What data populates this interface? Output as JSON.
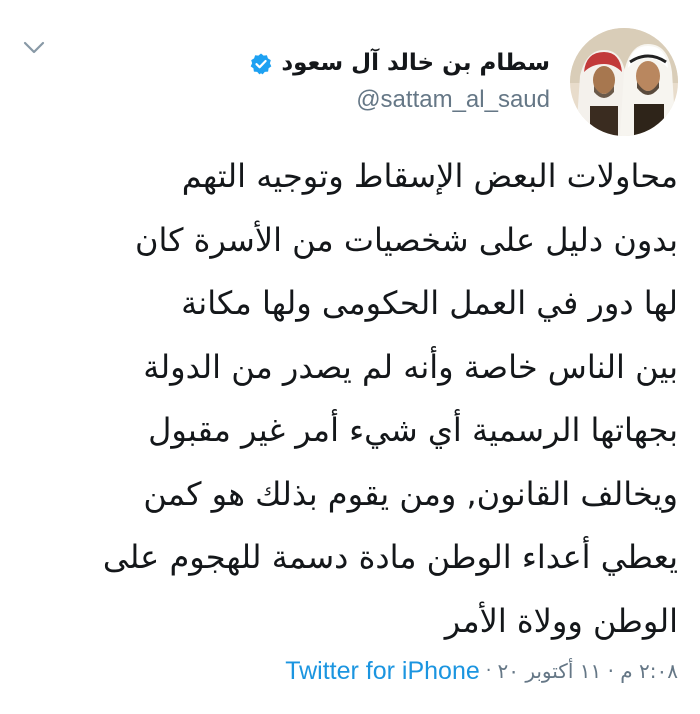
{
  "author": {
    "display_name": "سطام بن خالد آل سعود",
    "handle": "@sattam_al_saud",
    "verified": true
  },
  "icons": {
    "verified": "verified-badge-icon",
    "menu": "chevron-down-icon"
  },
  "tweet": {
    "lines": [
      "محاولات البعض الإسقاط وتوجيه التهم",
      "بدون دليل على شخصيات من الأسرة كان",
      "لها دور في العمل الحكومى ولها مكانة",
      "بين الناس خاصة وأنه لم يصدر من الدولة",
      "بجهاتها الرسمية أي شيء أمر غير مقبول",
      "ويخالف القانون, ومن يقوم بذلك هو كمن",
      "يعطي أعداء الوطن مادة دسمة للهجوم على",
      "الوطن وولاة الأمر"
    ]
  },
  "meta": {
    "timestamp": "٢:٠٨ م · ١١ أكتوبر ٢٠",
    "separator": "·",
    "source": "Twitter for iPhone"
  },
  "colors": {
    "text": "#14171a",
    "secondary": "#657786",
    "link": "#1b95e0",
    "verified": "#1da1f2"
  }
}
